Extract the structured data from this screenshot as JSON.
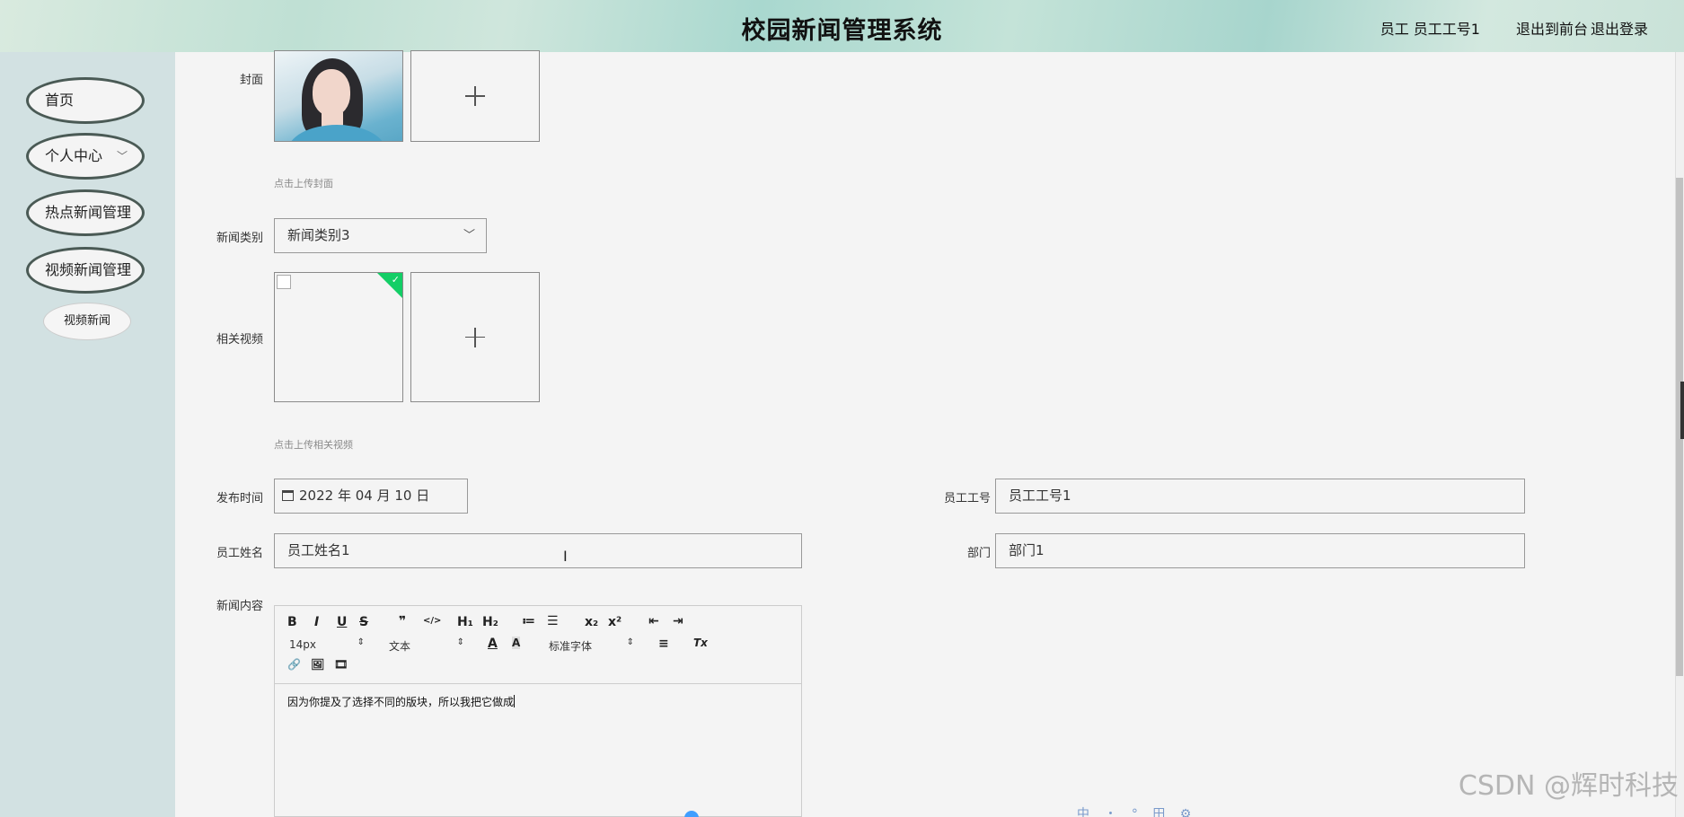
{
  "header": {
    "title": "校园新闻管理系统",
    "user_info": "员工 员工工号1",
    "to_front": "退出到前台",
    "logout": "退出登录"
  },
  "sidebar": {
    "items": [
      {
        "label": "首页"
      },
      {
        "label": "个人中心",
        "has_chevron": true,
        "chevron": "﹀"
      },
      {
        "label": "热点新闻管理"
      },
      {
        "label": "视频新闻管理"
      }
    ],
    "sub_item": "视频新闻"
  },
  "form": {
    "cover": {
      "label": "封面",
      "tip": "点击上传封面"
    },
    "category": {
      "label": "新闻类别",
      "value": "新闻类别3",
      "arrow": "﹀"
    },
    "video": {
      "label": "相关视频",
      "tip": "点击上传相关视频",
      "check": "✓"
    },
    "publish_time": {
      "label": "发布时间",
      "value": "2022 年 04 月 10 日",
      "icon": "calendar-icon"
    },
    "employee_no": {
      "label": "员工工号",
      "value": "员工工号1"
    },
    "employee_name": {
      "label": "员工姓名",
      "value": "员工姓名1"
    },
    "department": {
      "label": "部门",
      "value": "部门1"
    },
    "content": {
      "label": "新闻内容",
      "text": "因为你提及了选择不同的版块，所以我把它做成"
    }
  },
  "editor": {
    "row1": [
      "B",
      "I",
      "U",
      "S",
      "❞",
      "</>",
      "H₁",
      "H₂",
      "≔",
      "☰",
      "x₂",
      "x²",
      "⇤",
      "⇥"
    ],
    "font_size": "14px",
    "block_type": "文本",
    "font_family": "标准字体",
    "updown": "⇕",
    "color": "A",
    "bg_color": "A",
    "align": "≡",
    "clear": "Tx",
    "row3": [
      "🔗",
      "🖼",
      "🎞"
    ]
  },
  "watermark": "CSDN @辉时科技",
  "ime_bar": "中 ・ ° 田 ⚙",
  "colors": {
    "success_badge": "#13ce66",
    "sidebar_bg": "#d2e1e2",
    "page_bg": "#f4f4f4"
  }
}
